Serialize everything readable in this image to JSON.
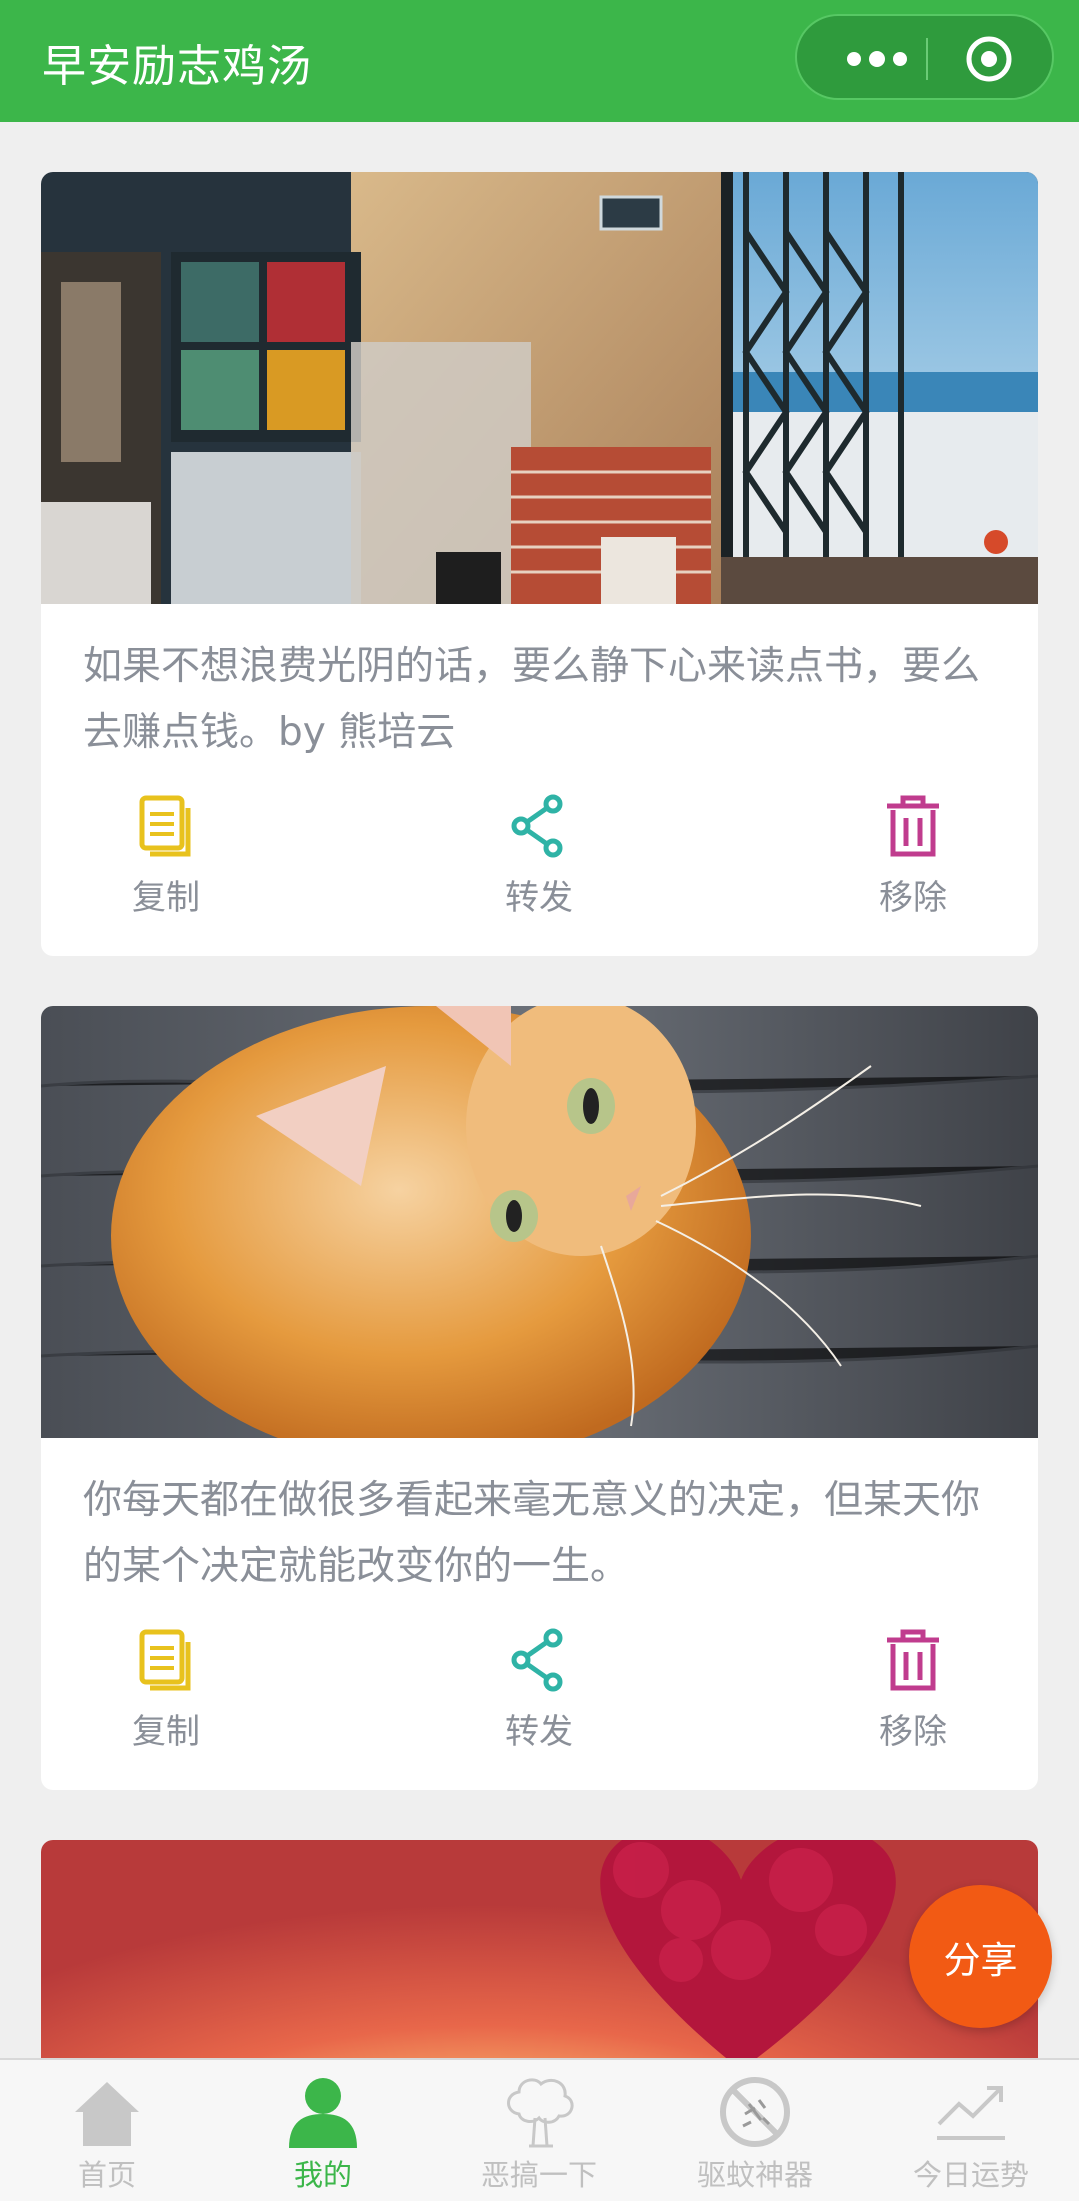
{
  "header": {
    "title": "早安励志鸡汤"
  },
  "cards": [
    {
      "text": "如果不想浪费光阴的话，要么静下心来读点书，要么去赚点钱。by 熊培云",
      "actions": [
        "复制",
        "转发",
        "移除"
      ]
    },
    {
      "text": "你每天都在做很多看起来毫无意义的决定，但某天你的某个决定就能改变你的一生。",
      "actions": [
        "复制",
        "转发",
        "移除"
      ]
    },
    {
      "text": "",
      "actions": []
    }
  ],
  "share_button": "分享",
  "tabbar": {
    "tabs": [
      {
        "label": "首页",
        "icon": "home-icon"
      },
      {
        "label": "我的",
        "icon": "person-icon"
      },
      {
        "label": "恶搞一下",
        "icon": "tree-icon"
      },
      {
        "label": "驱蚊神器",
        "icon": "no-mosquito-icon"
      },
      {
        "label": "今日运势",
        "icon": "trend-icon"
      }
    ],
    "active": "我的"
  },
  "colors": {
    "brand_green": "#3cb64a",
    "copy_yellow": "#e8c21d",
    "share_teal": "#2fb3a6",
    "remove_magenta": "#c03c8e",
    "fab_orange": "#f25a14"
  }
}
